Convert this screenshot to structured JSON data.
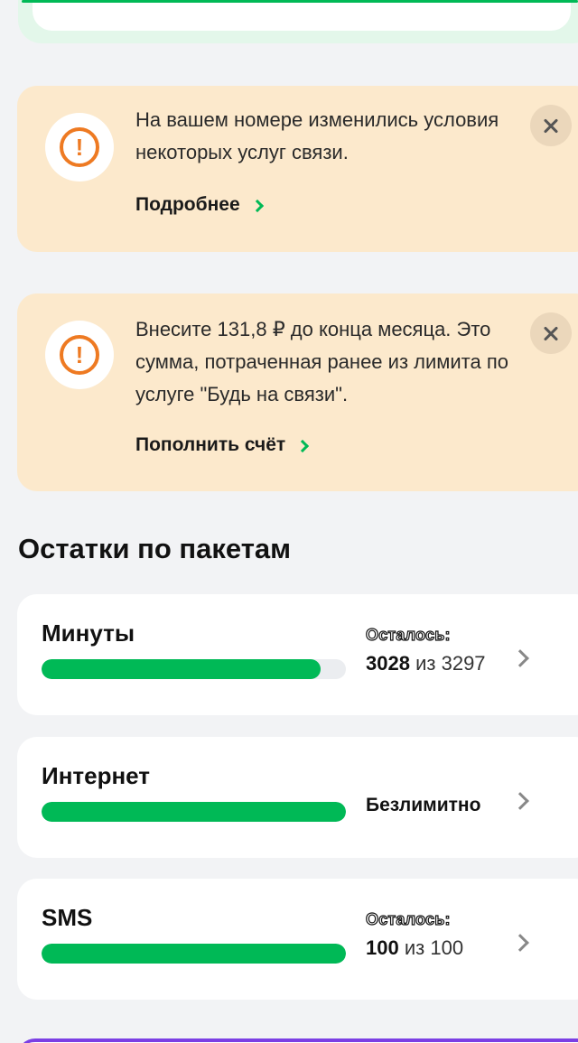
{
  "notices": [
    {
      "text": "На вашем номере изменились условия некоторых услуг связи.",
      "link": "Подробнее"
    },
    {
      "text": "Внесите 131,8 ₽ до конца месяца. Это сумма, потраченная ранее из лимита по услуге \"Будь на связи\".",
      "link": "Пополнить счёт"
    }
  ],
  "warning_symbol": "!",
  "section_title": "Остатки по пакетам",
  "packages": [
    {
      "name": "Минуты",
      "remain_label": "Осталось:",
      "remain_value": "3028",
      "remain_sep": "из",
      "remain_total": "3297",
      "fill_fraction": 0.918
    },
    {
      "name": "Интернет",
      "unlimited_label": "Безлимитно",
      "fill_fraction": 1.0
    },
    {
      "name": "SMS",
      "remain_label": "Осталось:",
      "remain_value": "100",
      "remain_sep": "из",
      "remain_total": "100",
      "fill_fraction": 1.0
    }
  ],
  "colors": {
    "accent_green": "#00b956",
    "warning_orange": "#ee7a22",
    "notice_bg": "#fce9cc",
    "bottom_card_accent": "#7b3fe4"
  },
  "icons": {
    "warning": "exclamation-circle-icon",
    "close": "close-icon",
    "chevron": "chevron-right-icon"
  }
}
